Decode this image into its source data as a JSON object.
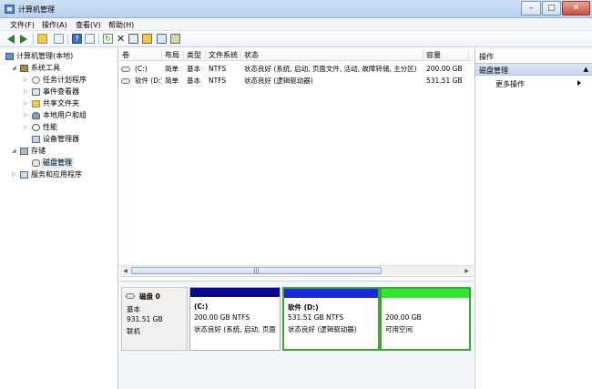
{
  "window": {
    "title": "计算机管理"
  },
  "menu": [
    "文件(F)",
    "操作(A)",
    "查看(V)",
    "帮助(H)"
  ],
  "toolbar": {
    "icons": [
      "back-icon",
      "forward-icon",
      "up-folder-icon",
      "show-hide-tree-icon",
      "help-icon",
      "properties-icon",
      "refresh-icon",
      "delete-icon",
      "new-icon",
      "open-icon",
      "search-icon",
      "settings-icon"
    ]
  },
  "tree": {
    "root": "计算机管理(本地)",
    "system_tools": "系统工具",
    "task_scheduler": "任务计划程序",
    "event_viewer": "事件查看器",
    "shared_folders": "共享文件夹",
    "local_users": "本地用户和组",
    "performance": "性能",
    "device_manager": "设备管理器",
    "storage": "存储",
    "disk_management": "磁盘管理",
    "services_apps": "服务和应用程序"
  },
  "volumes": {
    "headers": [
      "卷",
      "布局",
      "类型",
      "文件系统",
      "状态",
      "容量"
    ],
    "rows": [
      {
        "name": "(C:)",
        "layout": "简单",
        "type": "基本",
        "fs": "NTFS",
        "status": "状态良好 (系统, 启动, 页面文件, 活动, 故障转储, 主分区)",
        "capacity": "200.00 GB"
      },
      {
        "name": "软件 (D:)",
        "layout": "简单",
        "type": "基本",
        "fs": "NTFS",
        "status": "状态良好 (逻辑驱动器)",
        "capacity": "531.51 GB"
      }
    ],
    "scroll_grip": "|||"
  },
  "disk": {
    "name": "磁盘 0",
    "type": "基本",
    "size": "931.51 GB",
    "state": "联机",
    "partitions": [
      {
        "label": "(C:)",
        "size": "200.00 GB NTFS",
        "status": "状态良好 (系统, 启动, 页面",
        "color": "#0a0a8c"
      },
      {
        "label": "软件 (D:)",
        "size": "531.51 GB NTFS",
        "status": "状态良好 (逻辑驱动器)",
        "color": "#1a28e0"
      },
      {
        "label": "",
        "size": "200.00 GB",
        "status": "可用空间",
        "color": "#33e633"
      }
    ]
  },
  "actions": {
    "title": "操作",
    "section": "磁盘管理",
    "more": "更多操作"
  }
}
